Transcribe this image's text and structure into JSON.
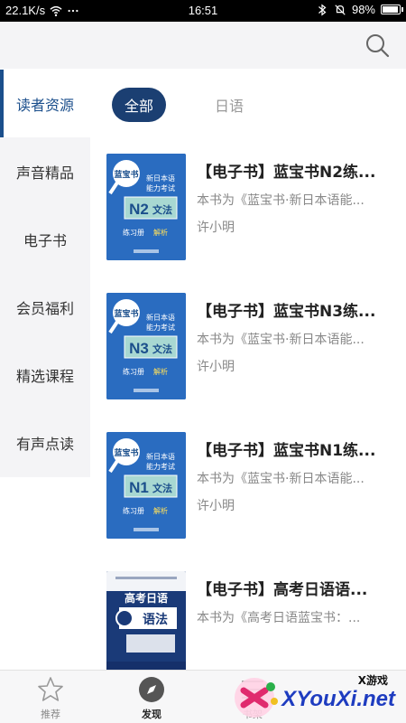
{
  "status_bar": {
    "speed": "22.1K/s",
    "time": "16:51",
    "battery": "98%",
    "battery_level": 0.98
  },
  "sidebar": {
    "items": [
      {
        "label": "读者资源"
      },
      {
        "label": "声音精品"
      },
      {
        "label": "电子书"
      },
      {
        "label": "会员福利"
      },
      {
        "label": "精选课程"
      },
      {
        "label": "有声点读"
      }
    ]
  },
  "filters": {
    "items": [
      {
        "label": "全部"
      },
      {
        "label": "日语"
      }
    ]
  },
  "books": [
    {
      "title": "【电子书】蓝宝书N2练...",
      "desc": "本书为《蓝宝书·新日本语能...",
      "author": "许小明",
      "cover": {
        "brand": "蓝宝书",
        "line1": "新日本语",
        "line2": "能力考试",
        "level": "N2",
        "subject": "文法",
        "tag1": "练习册",
        "tag2": "解析"
      }
    },
    {
      "title": "【电子书】蓝宝书N3练...",
      "desc": "本书为《蓝宝书·新日本语能...",
      "author": "许小明",
      "cover": {
        "brand": "蓝宝书",
        "line1": "新日本语",
        "line2": "能力考试",
        "level": "N3",
        "subject": "文法",
        "tag1": "练习册",
        "tag2": "解析"
      }
    },
    {
      "title": "【电子书】蓝宝书N1练...",
      "desc": "本书为《蓝宝书·新日本语能...",
      "author": "许小明",
      "cover": {
        "brand": "蓝宝书",
        "line1": "新日本语",
        "line2": "能力考试",
        "level": "N1",
        "subject": "文法",
        "tag1": "练习册",
        "tag2": "解析"
      }
    },
    {
      "title": "【电子书】高考日语语...",
      "desc": "本书为《高考日语蓝宝书：...",
      "author": "",
      "cover": {
        "brand": "高考日语",
        "subject": "语法"
      }
    }
  ],
  "bottom_nav": {
    "items": [
      {
        "label": "推荐",
        "icon": "star-icon"
      },
      {
        "label": "发现",
        "icon": "compass-icon"
      },
      {
        "label": "书架",
        "icon": "bookshelf-icon"
      }
    ]
  },
  "watermark": {
    "small": "X游戏",
    "big": "XYouXi.net"
  },
  "colors": {
    "accent": "#1b3f72",
    "sidebar_active": "#1b4f8c",
    "cover_blue": "#2a6cc0",
    "watermark": "#1e3cc0"
  }
}
